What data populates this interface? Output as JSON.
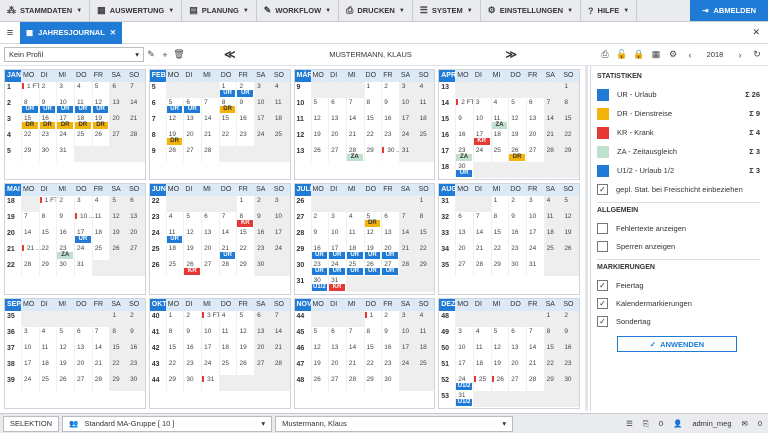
{
  "menu": [
    {
      "icon": "apps-icon",
      "glyph": "⁂",
      "label": "STAMMDATEN"
    },
    {
      "icon": "chart-icon",
      "glyph": "▦",
      "label": "AUSWERTUNG"
    },
    {
      "icon": "calendar-icon",
      "glyph": "▤",
      "label": "PLANUNG"
    },
    {
      "icon": "pen-icon",
      "glyph": "✎",
      "label": "WORKFLOW"
    },
    {
      "icon": "print-icon",
      "glyph": "⎙",
      "label": "DRUCKEN"
    },
    {
      "icon": "server-icon",
      "glyph": "☰",
      "label": "SYSTEM"
    },
    {
      "icon": "gear-icon",
      "glyph": "⚙",
      "label": "EINSTELLUNGEN"
    },
    {
      "icon": "help-icon",
      "glyph": "?",
      "label": "HILFE"
    }
  ],
  "logout_label": "ABMELDEN",
  "tab": {
    "label": "JAHRESJOURNAL",
    "close": "✕"
  },
  "window_close": "✕",
  "controls": {
    "profile": "Kein Profil",
    "employee": "MUSTERMANN, KLAUS",
    "prev": "≪",
    "next": "≫",
    "year": "2018",
    "year_prev": "‹",
    "year_next": "›"
  },
  "weekday_headers": [
    "MO",
    "DI",
    "MI",
    "DO",
    "FR",
    "SA",
    "SO"
  ],
  "months": [
    {
      "name": "JAN.",
      "first": 0,
      "days": 31,
      "startWeek": 1,
      "entries": {
        "8": "UR",
        "9": "UR",
        "10": "UR",
        "11": "UR",
        "12": "UR",
        "15": "DR",
        "16": "DR",
        "17": "DR",
        "18": "DR",
        "19": "DR"
      },
      "labels": {
        "1": "1 FT"
      },
      "marks": [
        1
      ]
    },
    {
      "name": "FEB.",
      "first": 3,
      "days": 28,
      "startWeek": 5,
      "entries": {
        "1": "UR",
        "2": "UR",
        "5": "UR",
        "6": "UR",
        "8": "DR",
        "19": "DR"
      }
    },
    {
      "name": "MÄRZ",
      "first": 3,
      "days": 31,
      "startWeek": 9,
      "entries": {
        "28": "ZA"
      },
      "labels": {
        "30": "30 ..."
      },
      "marks": [
        30
      ]
    },
    {
      "name": "APR.",
      "first": 6,
      "days": 30,
      "startWeek": 13,
      "entries": {
        "11": "ZA",
        "17": "KR",
        "23": "ZA",
        "26": "DR",
        "30": "UR"
      },
      "labels": {
        "2": "2 FT"
      },
      "marks": [
        2
      ]
    },
    {
      "name": "MAI",
      "first": 1,
      "days": 31,
      "startWeek": 18,
      "entries": {
        "17": "UR",
        "23": "ZA"
      },
      "labels": {
        "1": "1 FT",
        "10": "10 ...",
        "21": "21 ..."
      },
      "marks": [
        1,
        10,
        21
      ]
    },
    {
      "name": "JUNI",
      "first": 4,
      "days": 30,
      "startWeek": 22,
      "entries": {
        "8": "KR",
        "11": "UR",
        "21": "UR",
        "26": "KR"
      }
    },
    {
      "name": "JULI",
      "first": 6,
      "days": 31,
      "startWeek": 26,
      "entries": {
        "5": "DR",
        "16": "UR",
        "17": "UR",
        "18": "UR",
        "19": "UR",
        "20": "UR",
        "23": "UR",
        "24": "UR",
        "25": "UR",
        "26": "UR",
        "27": "UR",
        "30": "U1/2",
        "31": "KR"
      }
    },
    {
      "name": "AUG.",
      "first": 2,
      "days": 31,
      "startWeek": 31,
      "entries": {}
    },
    {
      "name": "SEP.",
      "first": 5,
      "days": 30,
      "startWeek": 35,
      "entries": {}
    },
    {
      "name": "OKT.",
      "first": 0,
      "days": 31,
      "startWeek": 40,
      "entries": {},
      "labels": {
        "3": "3 FT"
      },
      "marks": [
        3,
        31
      ]
    },
    {
      "name": "NOV.",
      "first": 3,
      "days": 30,
      "startWeek": 44,
      "entries": {},
      "marks": [
        1
      ]
    },
    {
      "name": "DEZ.",
      "first": 5,
      "days": 31,
      "startWeek": 48,
      "entries": {
        "24": "U1/2",
        "31": "U1/2"
      },
      "marks": [
        25,
        26
      ]
    }
  ],
  "panel": {
    "stats_title": "STATISTIKEN",
    "stats": [
      {
        "color": "#1f7bd6",
        "label": "UR - Urlaub",
        "count": "Σ 26"
      },
      {
        "color": "#f2b40b",
        "label": "DR - Dienstreise",
        "count": "Σ 9"
      },
      {
        "color": "#e53935",
        "label": "KR - Krank",
        "count": "Σ 4"
      },
      {
        "color": "#bfe0cc",
        "label": "ZA - Zeitausgleich",
        "count": "Σ 3"
      },
      {
        "color": "#1f7bd6",
        "label": "U1/2 - Urlaub 1/2",
        "count": "Σ 3"
      }
    ],
    "stats_option": "gepl. Stat. bei Freischicht einbeziehen",
    "general_title": "ALLGEMEIN",
    "general": [
      "Fehlertexte anzeigen",
      "Sperren anzeigen"
    ],
    "marks_title": "MARKIERUNGEN",
    "marks": [
      "Feiertag",
      "Kalendermarkierungen",
      "Sondertag"
    ],
    "apply_label": "ANWENDEN"
  },
  "status": {
    "selection": "SELEKTION",
    "group": "Standard MA-Gruppe  [ 10 ]",
    "employee": "Mustermann, Klaus",
    "pdf_count": "0",
    "user": "admin_meg",
    "mail_count": "0"
  }
}
